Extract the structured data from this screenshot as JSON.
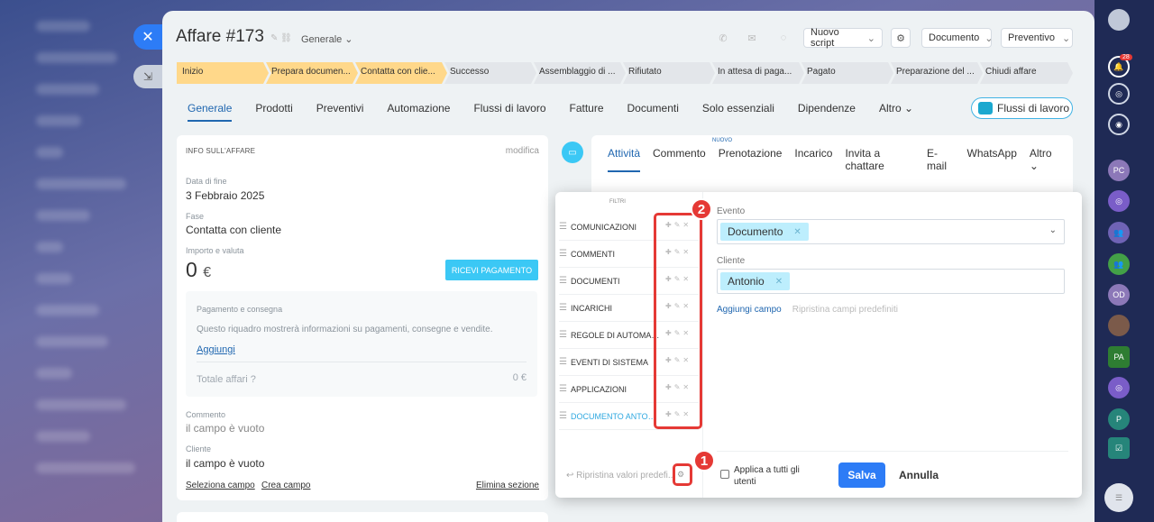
{
  "deal": {
    "title": "Affare #173",
    "category": "Generale ⌄",
    "toolbar": {
      "script_btn": "Nuovo script",
      "document_btn": "Documento",
      "quote_btn": "Preventivo"
    }
  },
  "stages": [
    {
      "label": "Inizio",
      "color": "#ffd88a"
    },
    {
      "label": "Prepara documen...",
      "color": "#ffd88a"
    },
    {
      "label": "Contatta con clie...",
      "color": "#ffd88a"
    },
    {
      "label": "Successo",
      "color": "#d5dbe2"
    },
    {
      "label": "Assemblaggio di ...",
      "color": "#d5dbe2"
    },
    {
      "label": "Rifiutato",
      "color": "#d5dbe2"
    },
    {
      "label": "In attesa di paga...",
      "color": "#d5dbe2"
    },
    {
      "label": "Pagato",
      "color": "#d5dbe2"
    },
    {
      "label": "Preparazione del ...",
      "color": "#d5dbe2"
    },
    {
      "label": "Chiudi affare",
      "color": "#d5dbe2"
    }
  ],
  "tabs": [
    "Generale",
    "Prodotti",
    "Preventivi",
    "Automazione",
    "Flussi di lavoro",
    "Fatture",
    "Documenti",
    "Solo essenziali",
    "Dipendenze",
    "Altro ⌄"
  ],
  "flussi_btn": "Flussi di lavoro",
  "info": {
    "header": "INFO SULL'AFFARE",
    "edit": "modifica",
    "end_date_label": "Data di fine",
    "end_date": "3 Febbraio 2025",
    "stage_label": "Fase",
    "stage": "Contatta con cliente",
    "amount_label": "Importo e valuta",
    "amount": "0",
    "currency": "€",
    "pay_btn": "RICEVI PAGAMENTO",
    "payment_title": "Pagamento e consegna",
    "payment_text": "Questo riquadro mostrerà informazioni su pagamenti, consegne e vendite.",
    "add_link": "Aggiungi",
    "total_label": "Totale affari",
    "total_value": "0 €",
    "comment_label": "Commento",
    "comment_value": "il campo è vuoto",
    "client_label": "Cliente",
    "client_value": "il campo è vuoto",
    "select_field": "Seleziona campo",
    "create_field": "Crea campo",
    "delete_section": "Elimina sezione"
  },
  "activity": {
    "tabs": [
      "Attività",
      "Commento",
      "Prenotazione",
      "Incarico",
      "Invita a chattare",
      "E-mail",
      "WhatsApp",
      "Altro ⌄"
    ],
    "new_badge": "NUOVO"
  },
  "filter_popup": {
    "title": "FILTRI",
    "items": [
      "COMUNICAZIONI",
      "COMMENTI",
      "DOCUMENTI",
      "INCARICHI",
      "REGOLE DI AUTOMAZIONE",
      "EVENTI DI SISTEMA",
      "APPLICAZIONI",
      "DOCUMENTO ANTONIO"
    ],
    "event_label": "Evento",
    "event_chip": "Documento",
    "client_label": "Cliente",
    "client_chip": "Antonio",
    "add_field": "Aggiungi campo",
    "reset_fields": "Ripristina campi predefiniti",
    "reset_defaults": "Ripristina valori predefi...",
    "apply_all": "Applica a tutti gli utenti",
    "save": "Salva",
    "cancel": "Annulla"
  },
  "annotations": {
    "one": "1",
    "two": "2",
    "color": "#e53935"
  },
  "notifications": {
    "count": "28"
  },
  "rightbar_avatars": [
    "PC",
    "OD",
    "PA",
    "P"
  ]
}
